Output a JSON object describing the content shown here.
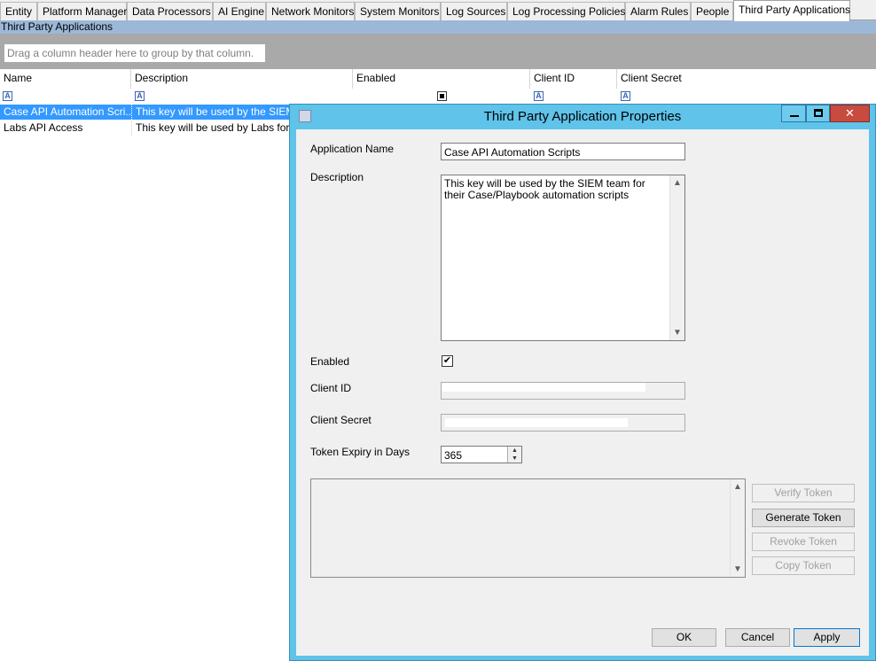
{
  "tabs": [
    {
      "label": "Entity"
    },
    {
      "label": "Platform Manager"
    },
    {
      "label": "Data Processors"
    },
    {
      "label": "AI Engine"
    },
    {
      "label": "Network Monitors"
    },
    {
      "label": "System Monitors"
    },
    {
      "label": "Log Sources"
    },
    {
      "label": "Log Processing Policies"
    },
    {
      "label": "Alarm Rules"
    },
    {
      "label": "People"
    },
    {
      "label": "Third Party Applications"
    }
  ],
  "section_title": "Third Party Applications",
  "group_panel_placeholder": "Drag a column header here to group by that column.",
  "grid": {
    "columns": [
      "Name",
      "Description",
      "Enabled",
      "Client ID",
      "Client Secret"
    ],
    "rows": [
      {
        "name": "Case API Automation Scri...",
        "description": "This key will be used by the SIEM"
      },
      {
        "name": "Labs API Access",
        "description": "This key will be used by Labs for A"
      }
    ]
  },
  "dialog": {
    "title": "Third Party Application Properties",
    "labels": {
      "app_name": "Application Name",
      "description": "Description",
      "enabled": "Enabled",
      "client_id": "Client ID",
      "client_secret": "Client Secret",
      "token_expiry": "Token Expiry in Days"
    },
    "app_name_value": "Case API Automation Scripts",
    "description_value": "This key will be used by the SIEM team for their Case/Playbook automation scripts",
    "enabled": true,
    "token_expiry_value": "365",
    "buttons": {
      "verify_token": "Verify Token",
      "generate_token": "Generate Token",
      "revoke_token": "Revoke Token",
      "copy_token": "Copy Token",
      "ok": "OK",
      "cancel": "Cancel",
      "apply": "Apply"
    }
  },
  "icons": {
    "filter": "filter-icon",
    "window": "app-window-icon"
  },
  "colors": {
    "selection": "#3399ff",
    "dialog_frame": "#5fc3ea",
    "close_button": "#c74b3e",
    "section_strip": "#9cb8d8",
    "group_panel": "#a9a9a9"
  }
}
